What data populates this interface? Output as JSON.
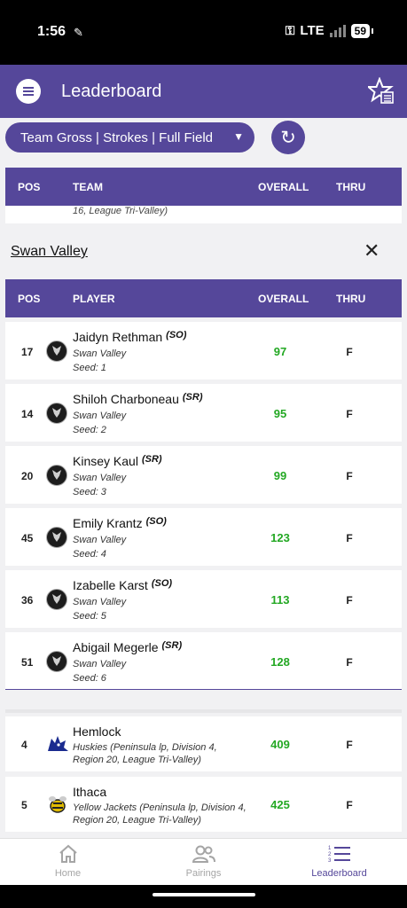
{
  "status_bar": {
    "time": "1:56",
    "network": "LTE",
    "battery": "59"
  },
  "header": {
    "title": "Leaderboard"
  },
  "filter": {
    "selected": "Team Gross | Strokes | Full Field"
  },
  "table_header": {
    "pos": "POS",
    "team": "TEAM",
    "overall": "OVERALL",
    "thru": "THRU"
  },
  "partial_row": {
    "subtitle": "16, League Tri-Valley)"
  },
  "team_section": {
    "title": "Swan Valley"
  },
  "player_header": {
    "pos": "POS",
    "player": "PLAYER",
    "overall": "OVERALL",
    "thru": "THRU"
  },
  "players": [
    {
      "pos": "17",
      "name": "Jaidyn Rethman",
      "class": "(SO)",
      "team": "Swan Valley",
      "seed": "Seed: 1",
      "overall": "97",
      "thru": "F"
    },
    {
      "pos": "14",
      "name": "Shiloh Charboneau",
      "class": "(SR)",
      "team": "Swan Valley",
      "seed": "Seed: 2",
      "overall": "95",
      "thru": "F"
    },
    {
      "pos": "20",
      "name": "Kinsey Kaul",
      "class": "(SR)",
      "team": "Swan Valley",
      "seed": "Seed: 3",
      "overall": "99",
      "thru": "F"
    },
    {
      "pos": "45",
      "name": "Emily Krantz",
      "class": "(SO)",
      "team": "Swan Valley",
      "seed": "Seed: 4",
      "overall": "123",
      "thru": "F"
    },
    {
      "pos": "36",
      "name": "Izabelle Karst",
      "class": "(SO)",
      "team": "Swan Valley",
      "seed": "Seed: 5",
      "overall": "113",
      "thru": "F"
    },
    {
      "pos": "51",
      "name": "Abigail Megerle",
      "class": "(SR)",
      "team": "Swan Valley",
      "seed": "Seed: 6",
      "overall": "128",
      "thru": "F"
    }
  ],
  "teams": [
    {
      "pos": "4",
      "name": "Hemlock",
      "subtitle": "Huskies (Peninsula lp, Division 4, Region 20, League Tri-Valley)",
      "overall": "409",
      "thru": "F",
      "logo": "husky-logo"
    },
    {
      "pos": "5",
      "name": "Ithaca",
      "subtitle": "Yellow Jackets (Peninsula lp, Division 4, Region 20, League Tri-Valley)",
      "overall": "425",
      "thru": "F",
      "logo": "yellow-jacket-logo"
    }
  ],
  "nav": {
    "home": "Home",
    "pairings": "Pairings",
    "leaderboard": "Leaderboard"
  },
  "colors": {
    "primary": "#55479a",
    "score_green": "#23a823"
  }
}
